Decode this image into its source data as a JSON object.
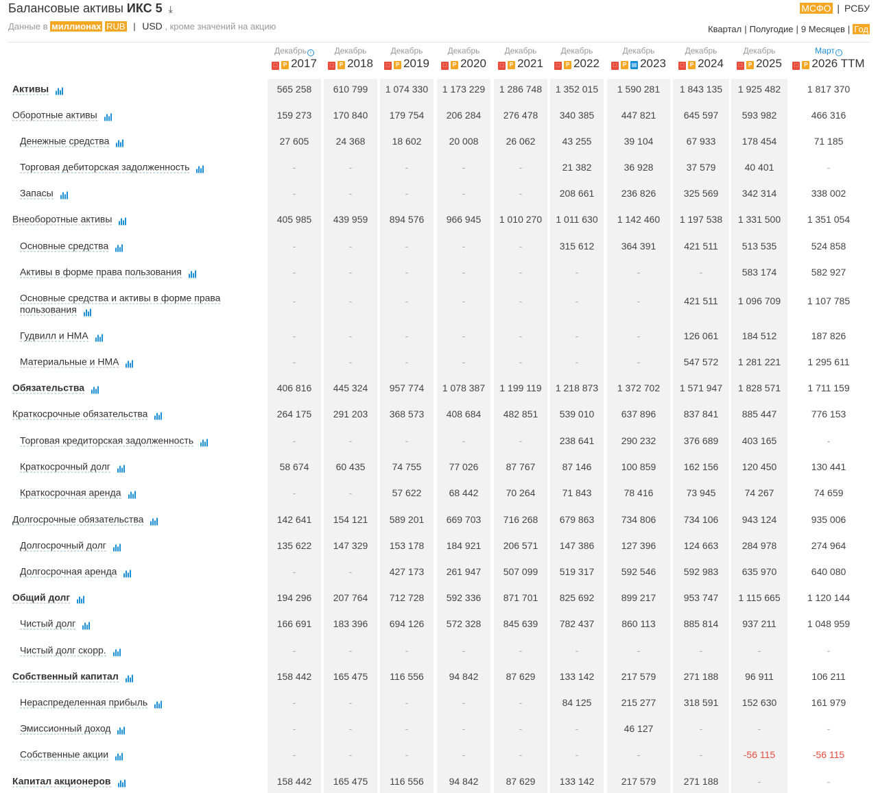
{
  "header": {
    "title_prefix": "Балансовые активы",
    "company": "ИКС 5",
    "download_icon": "download-icon",
    "data_in": "Данные в",
    "unit": "миллионах",
    "currency_rub": "RUB",
    "currency_usd": "USD",
    "note": ", кроме значений на акцию"
  },
  "standards": {
    "active": "МСФО",
    "other": "РСБУ"
  },
  "periods": [
    "Квартал",
    "Полугодие",
    "9 Месяцев",
    "Год"
  ],
  "active_period": "Год",
  "columns": [
    {
      "month": "Декабрь",
      "info": true,
      "year": "2017",
      "icons": [
        "pdf",
        "p"
      ]
    },
    {
      "month": "Декабрь",
      "info": false,
      "year": "2018",
      "icons": [
        "pdf",
        "p"
      ]
    },
    {
      "month": "Декабрь",
      "info": false,
      "year": "2019",
      "icons": [
        "pdf",
        "p"
      ]
    },
    {
      "month": "Декабрь",
      "info": false,
      "year": "2020",
      "icons": [
        "pdf",
        "p"
      ]
    },
    {
      "month": "Декабрь",
      "info": false,
      "year": "2021",
      "icons": [
        "pdf",
        "p"
      ]
    },
    {
      "month": "Декабрь",
      "info": false,
      "year": "2022",
      "icons": [
        "pdf",
        "p"
      ]
    },
    {
      "month": "Декабрь",
      "info": false,
      "year": "2023",
      "icons": [
        "pdf",
        "p",
        "doc"
      ]
    },
    {
      "month": "Декабрь",
      "info": false,
      "year": "2024",
      "icons": [
        "pdf",
        "p"
      ]
    },
    {
      "month": "Декабрь",
      "info": false,
      "year": "2025",
      "icons": [
        "pdf",
        "p"
      ]
    },
    {
      "month": "Март",
      "info": true,
      "year": "2026 TTM",
      "icons": [
        "pdf",
        "p"
      ],
      "accent": true
    }
  ],
  "rows": [
    {
      "label": "Активы",
      "level": 0,
      "bold": true,
      "values": [
        "565 258",
        "610 799",
        "1 074 330",
        "1 173 229",
        "1 286 748",
        "1 352 015",
        "1 590 281",
        "1 843 135",
        "1 925 482",
        "1 817 370"
      ]
    },
    {
      "label": "Оборотные активы",
      "level": 0,
      "bold": false,
      "values": [
        "159 273",
        "170 840",
        "179 754",
        "206 284",
        "276 478",
        "340 385",
        "447 821",
        "645 597",
        "593 982",
        "466 316"
      ]
    },
    {
      "label": "Денежные средства",
      "level": 1,
      "bold": false,
      "values": [
        "27 605",
        "24 368",
        "18 602",
        "20 008",
        "26 062",
        "43 255",
        "39 104",
        "67 933",
        "178 454",
        "71 185"
      ]
    },
    {
      "label": "Торговая дебиторская задолженность",
      "level": 1,
      "bold": false,
      "values": [
        "-",
        "-",
        "-",
        "-",
        "-",
        "21 382",
        "36 928",
        "37 579",
        "40 401",
        "-"
      ]
    },
    {
      "label": "Запасы",
      "level": 1,
      "bold": false,
      "values": [
        "-",
        "-",
        "-",
        "-",
        "-",
        "208 661",
        "236 826",
        "325 569",
        "342 314",
        "338 002"
      ]
    },
    {
      "label": "Внеоборотные активы",
      "level": 0,
      "bold": false,
      "values": [
        "405 985",
        "439 959",
        "894 576",
        "966 945",
        "1 010 270",
        "1 011 630",
        "1 142 460",
        "1 197 538",
        "1 331 500",
        "1 351 054"
      ]
    },
    {
      "label": "Основные средства",
      "level": 1,
      "bold": false,
      "values": [
        "-",
        "-",
        "-",
        "-",
        "-",
        "315 612",
        "364 391",
        "421 511",
        "513 535",
        "524 858"
      ]
    },
    {
      "label": "Активы в форме права пользования",
      "level": 1,
      "bold": false,
      "values": [
        "-",
        "-",
        "-",
        "-",
        "-",
        "-",
        "-",
        "-",
        "583 174",
        "582 927"
      ]
    },
    {
      "label": "Основные средства и активы в форме права пользования",
      "level": 1,
      "bold": false,
      "wrap": true,
      "values": [
        "-",
        "-",
        "-",
        "-",
        "-",
        "-",
        "-",
        "421 511",
        "1 096 709",
        "1 107 785"
      ]
    },
    {
      "label": "Гудвилл и НМА",
      "level": 1,
      "bold": false,
      "values": [
        "-",
        "-",
        "-",
        "-",
        "-",
        "-",
        "-",
        "126 061",
        "184 512",
        "187 826"
      ]
    },
    {
      "label": "Материальные и НМА",
      "level": 1,
      "bold": false,
      "values": [
        "-",
        "-",
        "-",
        "-",
        "-",
        "-",
        "-",
        "547 572",
        "1 281 221",
        "1 295 611"
      ]
    },
    {
      "label": "Обязательства",
      "level": 0,
      "bold": true,
      "values": [
        "406 816",
        "445 324",
        "957 774",
        "1 078 387",
        "1 199 119",
        "1 218 873",
        "1 372 702",
        "1 571 947",
        "1 828 571",
        "1 711 159"
      ]
    },
    {
      "label": "Краткосрочные обязательства",
      "level": 0,
      "bold": false,
      "values": [
        "264 175",
        "291 203",
        "368 573",
        "408 684",
        "482 851",
        "539 010",
        "637 896",
        "837 841",
        "885 447",
        "776 153"
      ]
    },
    {
      "label": "Торговая кредиторская задолженность",
      "level": 1,
      "bold": false,
      "values": [
        "-",
        "-",
        "-",
        "-",
        "-",
        "238 641",
        "290 232",
        "376 689",
        "403 165",
        "-"
      ]
    },
    {
      "label": "Краткосрочный долг",
      "level": 1,
      "bold": false,
      "values": [
        "58 674",
        "60 435",
        "74 755",
        "77 026",
        "87 767",
        "87 146",
        "100 859",
        "162 156",
        "120 450",
        "130 441"
      ]
    },
    {
      "label": "Краткосрочная аренда",
      "level": 1,
      "bold": false,
      "values": [
        "-",
        "-",
        "57 622",
        "68 442",
        "70 264",
        "71 843",
        "78 416",
        "73 945",
        "74 267",
        "74 659"
      ]
    },
    {
      "label": "Долгосрочные обязательства",
      "level": 0,
      "bold": false,
      "values": [
        "142 641",
        "154 121",
        "589 201",
        "669 703",
        "716 268",
        "679 863",
        "734 806",
        "734 106",
        "943 124",
        "935 006"
      ]
    },
    {
      "label": "Долгосрочный долг",
      "level": 1,
      "bold": false,
      "values": [
        "135 622",
        "147 329",
        "153 178",
        "184 921",
        "206 571",
        "147 386",
        "127 396",
        "124 663",
        "284 978",
        "274 964"
      ]
    },
    {
      "label": "Долгосрочная аренда",
      "level": 1,
      "bold": false,
      "values": [
        "-",
        "-",
        "427 173",
        "261 947",
        "507 099",
        "519 317",
        "592 546",
        "592 983",
        "635 970",
        "640 080"
      ]
    },
    {
      "label": "Общий долг",
      "level": 0,
      "bold": true,
      "values": [
        "194 296",
        "207 764",
        "712 728",
        "592 336",
        "871 701",
        "825 692",
        "899 217",
        "953 747",
        "1 115 665",
        "1 120 144"
      ]
    },
    {
      "label": "Чистый долг",
      "level": 1,
      "bold": false,
      "values": [
        "166 691",
        "183 396",
        "694 126",
        "572 328",
        "845 639",
        "782 437",
        "860 113",
        "885 814",
        "937 211",
        "1 048 959"
      ]
    },
    {
      "label": "Чистый долг скорр.",
      "level": 1,
      "bold": false,
      "values": [
        "-",
        "-",
        "-",
        "-",
        "-",
        "-",
        "-",
        "-",
        "-",
        "-"
      ]
    },
    {
      "label": "Собственный капитал",
      "level": 0,
      "bold": true,
      "values": [
        "158 442",
        "165 475",
        "116 556",
        "94 842",
        "87 629",
        "133 142",
        "217 579",
        "271 188",
        "96 911",
        "106 211"
      ]
    },
    {
      "label": "Нераспределенная прибыль",
      "level": 1,
      "bold": false,
      "values": [
        "-",
        "-",
        "-",
        "-",
        "-",
        "84 125",
        "215 277",
        "318 591",
        "152 630",
        "161 979"
      ]
    },
    {
      "label": "Эмиссионный доход",
      "level": 1,
      "bold": false,
      "values": [
        "-",
        "-",
        "-",
        "-",
        "-",
        "-",
        "46 127",
        "-",
        "-",
        "-"
      ]
    },
    {
      "label": "Собственные акции",
      "level": 1,
      "bold": false,
      "values": [
        "-",
        "-",
        "-",
        "-",
        "-",
        "-",
        "-",
        "-",
        "-56 115",
        "-56 115"
      ]
    },
    {
      "label": "Капитал акционеров",
      "level": 0,
      "bold": true,
      "values": [
        "158 442",
        "165 475",
        "116 556",
        "94 842",
        "87 629",
        "133 142",
        "217 579",
        "271 188",
        "-",
        "-"
      ]
    }
  ]
}
